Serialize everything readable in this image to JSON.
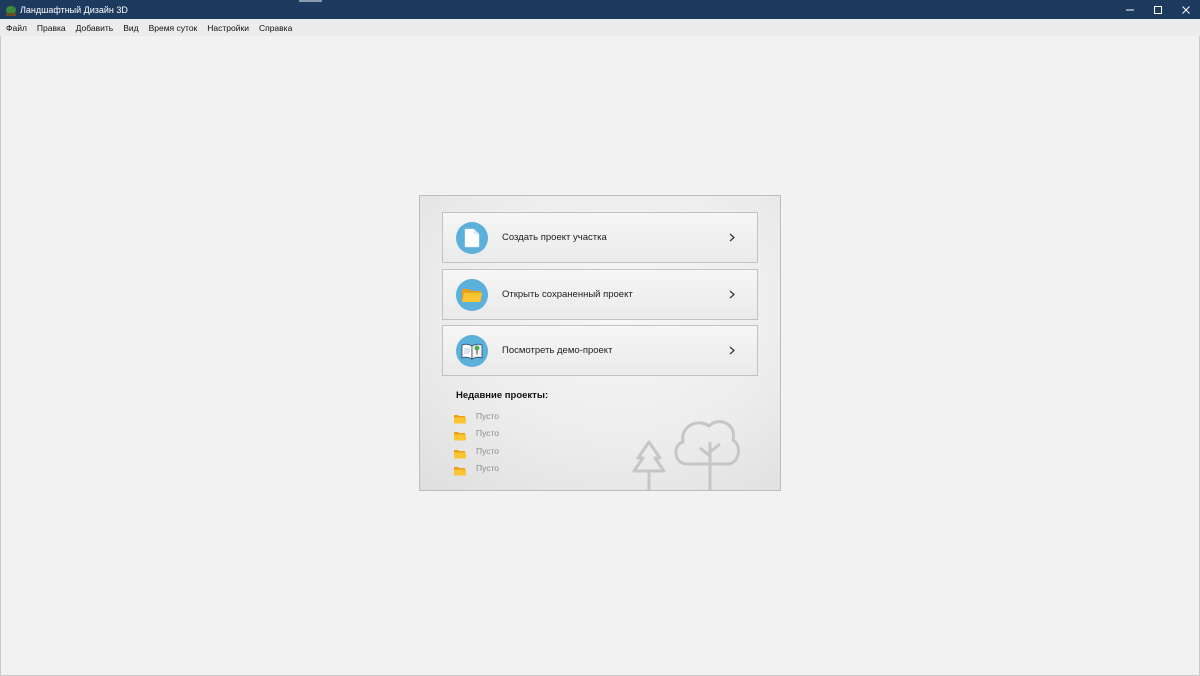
{
  "window": {
    "title": "Ландшафтный Дизайн 3D",
    "app_icon": "tree-app-icon"
  },
  "menu": [
    "Файл",
    "Правка",
    "Добавить",
    "Вид",
    "Время суток",
    "Настройки",
    "Справка"
  ],
  "start_panel": {
    "actions": [
      {
        "label": "Создать проект участка",
        "icon": "new-document-icon"
      },
      {
        "label": "Открыть сохраненный проект",
        "icon": "folder-icon"
      },
      {
        "label": "Посмотреть демо-проект",
        "icon": "demo-book-icon"
      }
    ],
    "recent_title": "Недавние проекты:",
    "recent_items": [
      "Пусто",
      "Пусто",
      "Пусто",
      "Пусто"
    ]
  },
  "colors": {
    "titlebar": "#1d3a5f",
    "accent_circle": "#5bb0dc",
    "folder": "#f5b21c"
  }
}
